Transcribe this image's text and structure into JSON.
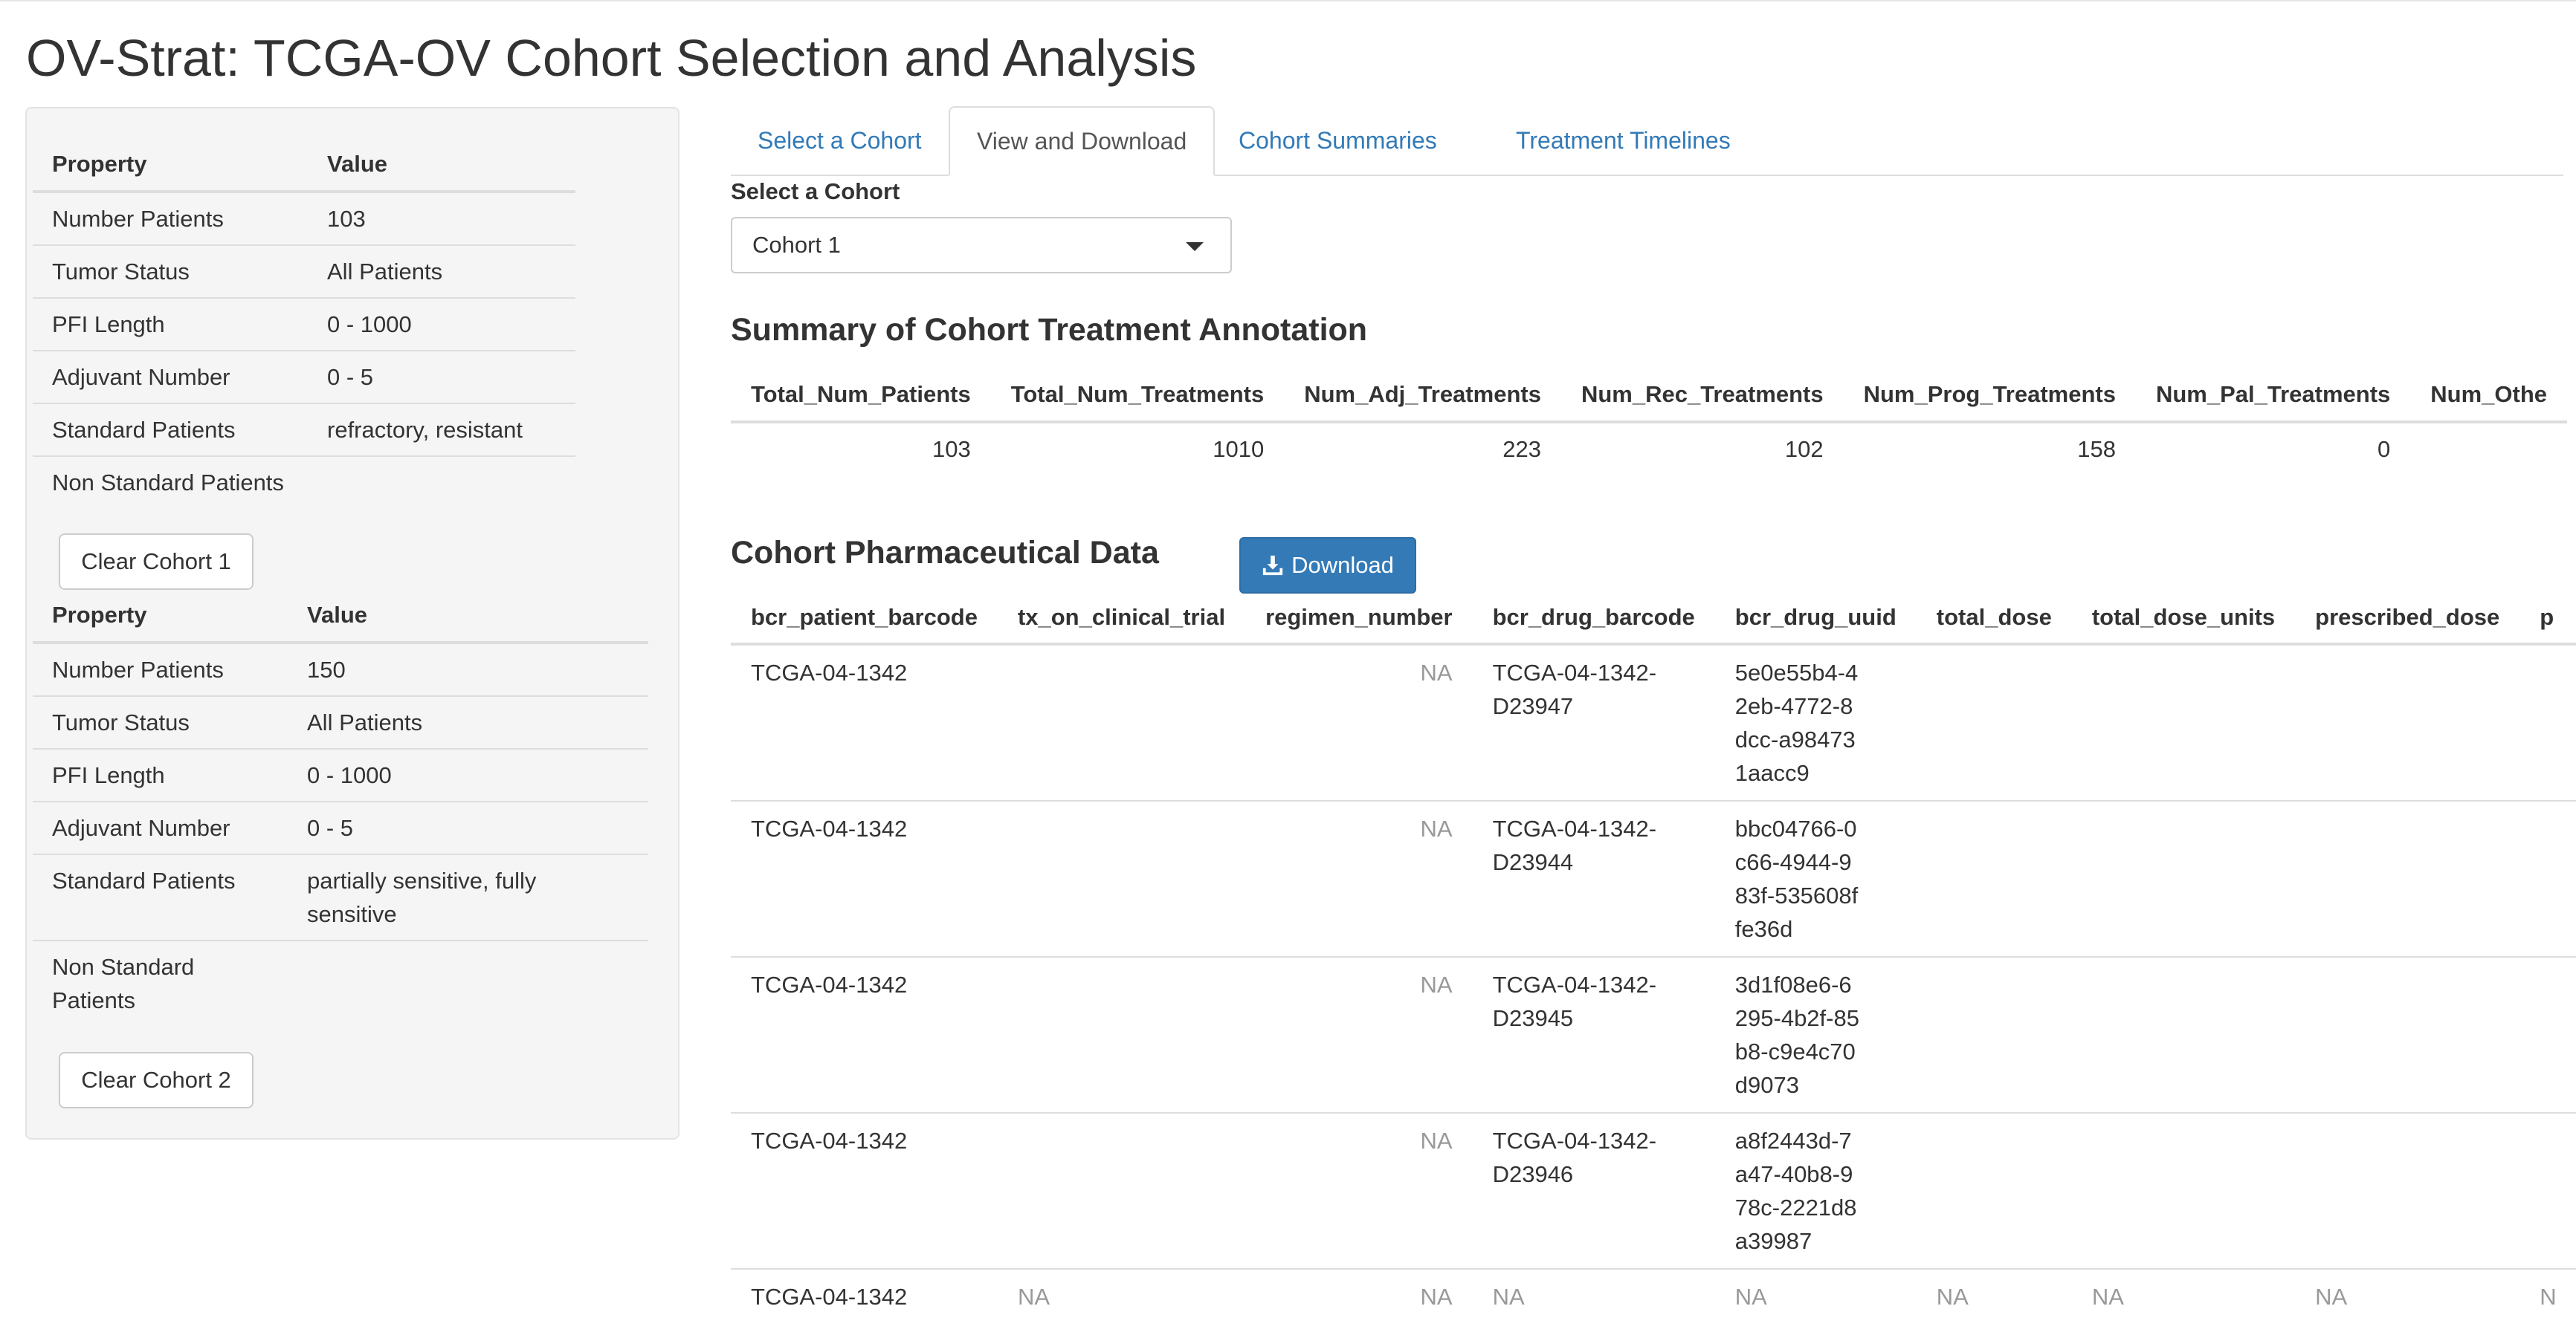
{
  "app": {
    "title": "OV-Strat: TCGA-OV Cohort Selection and Analysis"
  },
  "sidebar": {
    "cohort1": {
      "headers": [
        "Property",
        "Value"
      ],
      "rows": [
        [
          "Number Patients",
          "103"
        ],
        [
          "Tumor Status",
          "All Patients"
        ],
        [
          "PFI Length",
          "0 - 1000"
        ],
        [
          "Adjuvant Number",
          "0 - 5"
        ],
        [
          "Standard Patients",
          "refractory, resistant"
        ],
        [
          "Non Standard Patients",
          ""
        ]
      ],
      "clear_label": "Clear Cohort 1"
    },
    "cohort2": {
      "headers": [
        "Property",
        "Value"
      ],
      "rows": [
        [
          "Number Patients",
          "150"
        ],
        [
          "Tumor Status",
          "All Patients"
        ],
        [
          "PFI Length",
          "0 - 1000"
        ],
        [
          "Adjuvant Number",
          "0 - 5"
        ],
        [
          "Standard Patients",
          "partially sensitive, fully sensitive"
        ],
        [
          "Non Standard Patients",
          ""
        ]
      ],
      "clear_label": "Clear Cohort 2"
    }
  },
  "tabs": [
    {
      "label": "Select a Cohort",
      "active": false
    },
    {
      "label": "View and Download",
      "active": true
    },
    {
      "label": "Cohort Summaries",
      "active": false
    },
    {
      "label": "Treatment Timelines",
      "active": false
    }
  ],
  "cohort_select": {
    "label": "Select a Cohort",
    "value": "Cohort 1"
  },
  "summary": {
    "title": "Summary of Cohort Treatment Annotation",
    "headers": [
      "Total_Num_Patients",
      "Total_Num_Treatments",
      "Num_Adj_Treatments",
      "Num_Rec_Treatments",
      "Num_Prog_Treatments",
      "Num_Pal_Treatments",
      "Num_Othe"
    ],
    "values": [
      "103",
      "1010",
      "223",
      "102",
      "158",
      "0",
      ""
    ]
  },
  "pharma": {
    "title": "Cohort Pharmaceutical Data",
    "download_label": "Download",
    "headers": [
      "bcr_patient_barcode",
      "tx_on_clinical_trial",
      "regimen_number",
      "bcr_drug_barcode",
      "bcr_drug_uuid",
      "total_dose",
      "total_dose_units",
      "prescribed_dose",
      "p"
    ],
    "rows": [
      [
        "TCGA-04-1342",
        "",
        "NA",
        "TCGA-04-1342-D23947",
        "5e0e55b4-42eb-4772-8dcc-a984731aacc9",
        "",
        "",
        "",
        ""
      ],
      [
        "TCGA-04-1342",
        "",
        "NA",
        "TCGA-04-1342-D23944",
        "bbc04766-0c66-4944-983f-535608ffe36d",
        "",
        "",
        "",
        ""
      ],
      [
        "TCGA-04-1342",
        "",
        "NA",
        "TCGA-04-1342-D23945",
        "3d1f08e6-6295-4b2f-85b8-c9e4c70d9073",
        "",
        "",
        "",
        ""
      ],
      [
        "TCGA-04-1342",
        "",
        "NA",
        "TCGA-04-1342-D23946",
        "a8f2443d-7a47-40b8-978c-2221d8a39987",
        "",
        "",
        "",
        ""
      ],
      [
        "TCGA-04-1342",
        "NA",
        "NA",
        "NA",
        "NA",
        "NA",
        "NA",
        "NA",
        "N"
      ]
    ]
  }
}
